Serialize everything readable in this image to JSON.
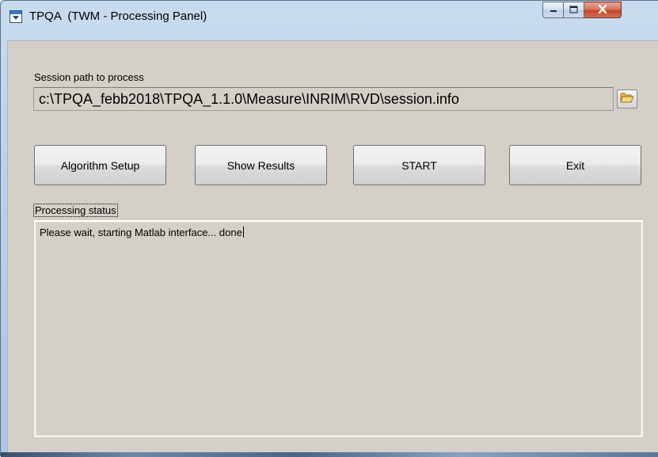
{
  "window": {
    "title": "TPQA  (TWM - Processing Panel)",
    "icon": "app-window-icon"
  },
  "caption_buttons": {
    "minimize_icon": "minimize-icon",
    "maximize_icon": "maximize-icon",
    "close_icon": "close-icon"
  },
  "session": {
    "label": "Session path to process",
    "path_value": "c:\\TPQA_febb2018\\TPQA_1.1.0\\Measure\\INRIM\\RVD\\session.info",
    "browse_icon": "folder-open-icon"
  },
  "buttons": {
    "algorithm_setup": "Algorithm Setup",
    "show_results": "Show Results",
    "start": "START",
    "exit": "Exit"
  },
  "status": {
    "label": "Processing status",
    "text": "Please wait, starting Matlab interface... done"
  },
  "colors": {
    "window_face": "#d4d0c8",
    "title_frame": "#b9d1ea",
    "close_button": "#c2462a"
  }
}
